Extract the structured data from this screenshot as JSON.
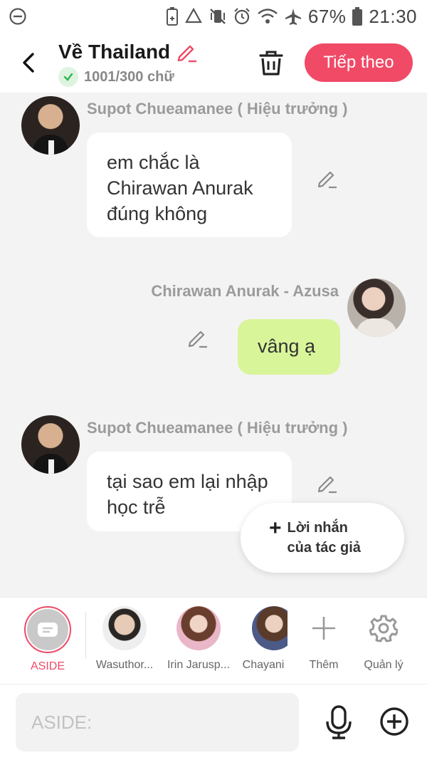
{
  "status": {
    "battery_percent": "67%",
    "time": "21:30"
  },
  "header": {
    "title": "Về Thailand",
    "word_count": "1001/300 chữ",
    "next_label": "Tiếp theo"
  },
  "messages": [
    {
      "sender": "Supot Chueamanee ( Hiệu trưởng )",
      "text": "em chắc là Chirawan Anurak đúng không",
      "side": "left"
    },
    {
      "sender": "Chirawan Anurak  - Azusa",
      "text": "vâng ạ",
      "side": "right"
    },
    {
      "sender": "Supot Chueamanee ( Hiệu trưởng )",
      "text": "tại sao em lại nhập học trễ",
      "side": "left"
    }
  ],
  "author_note": {
    "label": "Lời nhắn của tác giả"
  },
  "characters": {
    "aside": "ASIDE",
    "list": [
      "Wasuthor...",
      "Irin Jarusp...",
      "Chayani"
    ],
    "add_label": "Thêm",
    "manage_label": "Quản lý"
  },
  "input": {
    "placeholder": "ASIDE:"
  },
  "colors": {
    "accent": "#f04a67",
    "my_bubble": "#d9f59a",
    "check_green": "#2fb84a"
  }
}
